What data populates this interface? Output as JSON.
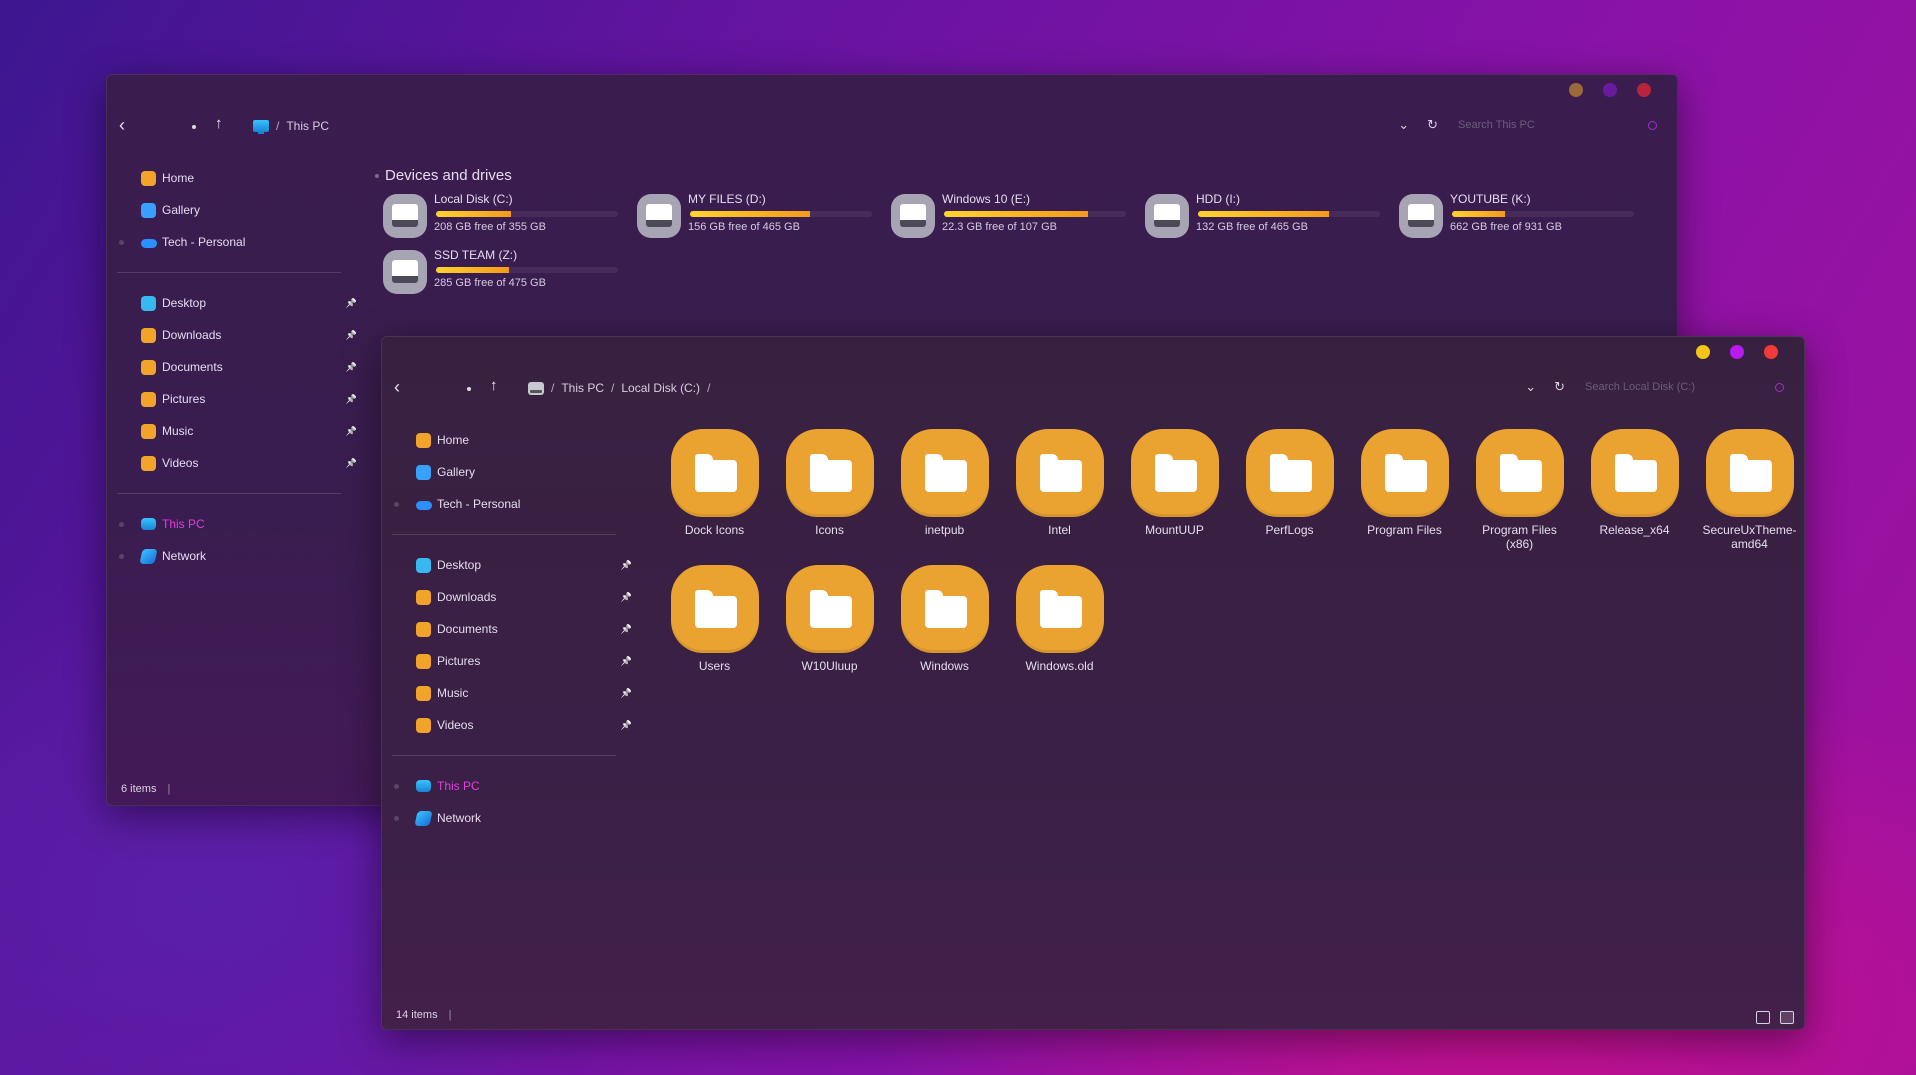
{
  "back_window": {
    "window_buttons": {
      "colors": [
        "#9a6a3c",
        "#6a1aa0",
        "#b8253a"
      ]
    },
    "breadcrumb": [
      "This PC"
    ],
    "search": {
      "placeholder": "Search This PC"
    },
    "sidebar": {
      "group1": [
        {
          "label": "Home",
          "icon": "home-icon"
        },
        {
          "label": "Gallery",
          "icon": "gallery-icon"
        },
        {
          "label": "Tech - Personal",
          "icon": "onedrive-icon"
        }
      ],
      "group2": [
        {
          "label": "Desktop",
          "icon": "desktop-folder-icon",
          "pinned": true
        },
        {
          "label": "Downloads",
          "icon": "downloads-folder-icon",
          "pinned": true
        },
        {
          "label": "Documents",
          "icon": "documents-folder-icon",
          "pinned": true
        },
        {
          "label": "Pictures",
          "icon": "pictures-folder-icon",
          "pinned": true
        },
        {
          "label": "Music",
          "icon": "music-folder-icon",
          "pinned": true
        },
        {
          "label": "Videos",
          "icon": "videos-folder-icon",
          "pinned": true
        }
      ],
      "group3": [
        {
          "label": "This PC",
          "icon": "this-pc-icon",
          "selected": true
        },
        {
          "label": "Network",
          "icon": "network-icon"
        }
      ]
    },
    "section_title": "Devices and drives",
    "drives": [
      {
        "name": "Local Disk (C:)",
        "free_text": "208 GB free of 355 GB",
        "used_fraction": 0.41
      },
      {
        "name": "MY FILES (D:)",
        "free_text": "156 GB free of 465 GB",
        "used_fraction": 0.66
      },
      {
        "name": "Windows 10 (E:)",
        "free_text": "22.3 GB free of 107 GB",
        "used_fraction": 0.79
      },
      {
        "name": "HDD (I:)",
        "free_text": "132 GB free of 465 GB",
        "used_fraction": 0.72
      },
      {
        "name": "YOUTUBE (K:)",
        "free_text": "662 GB free of 931 GB",
        "used_fraction": 0.29
      },
      {
        "name": "SSD TEAM (Z:)",
        "free_text": "285 GB free of 475 GB",
        "used_fraction": 0.4
      }
    ],
    "status": "6 items"
  },
  "front_window": {
    "window_buttons": {
      "colors": [
        "#f5c518",
        "#b71bf0",
        "#f23a3a"
      ]
    },
    "breadcrumb": [
      "This PC",
      "Local Disk (C:)"
    ],
    "search": {
      "placeholder": "Search Local Disk (C:)"
    },
    "sidebar": {
      "group1": [
        {
          "label": "Home",
          "icon": "home-icon"
        },
        {
          "label": "Gallery",
          "icon": "gallery-icon"
        },
        {
          "label": "Tech - Personal",
          "icon": "onedrive-icon"
        }
      ],
      "group2": [
        {
          "label": "Desktop",
          "icon": "desktop-folder-icon",
          "pinned": true
        },
        {
          "label": "Downloads",
          "icon": "downloads-folder-icon",
          "pinned": true
        },
        {
          "label": "Documents",
          "icon": "documents-folder-icon",
          "pinned": true
        },
        {
          "label": "Pictures",
          "icon": "pictures-folder-icon",
          "pinned": true
        },
        {
          "label": "Music",
          "icon": "music-folder-icon",
          "pinned": true
        },
        {
          "label": "Videos",
          "icon": "videos-folder-icon",
          "pinned": true
        }
      ],
      "group3": [
        {
          "label": "This PC",
          "icon": "this-pc-icon",
          "selected": true
        },
        {
          "label": "Network",
          "icon": "network-icon"
        }
      ]
    },
    "folders": [
      "Dock Icons",
      "Icons",
      "inetpub",
      "Intel",
      "MountUUP",
      "PerfLogs",
      "Program Files",
      "Program Files (x86)",
      "Release_x64",
      "SecureUxTheme-amd64",
      "Users",
      "W10Uluup",
      "Windows",
      "Windows.old"
    ],
    "status": "14 items"
  },
  "colors": {
    "accent_selected": "#e23ce0",
    "folder_orange": "#eaa231",
    "drive_bar_start": "#ffd42e",
    "drive_bar_end": "#f39a1a"
  }
}
